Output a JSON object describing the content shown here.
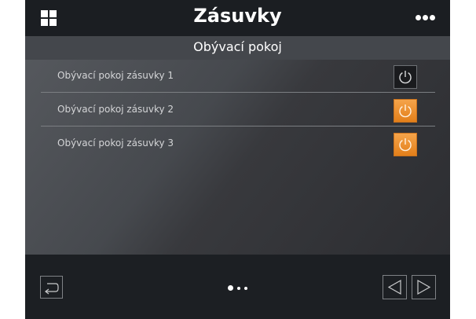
{
  "header": {
    "title": "Zásuvky",
    "menu_icon": "grid-icon",
    "more_icon": "more-dots-icon"
  },
  "room": {
    "title": "Obývací pokoj"
  },
  "outlets": [
    {
      "label": "Obývací pokoj zásuvky 1",
      "state": "off"
    },
    {
      "label": "Obývací pokoj zásuvky 2",
      "state": "on"
    },
    {
      "label": "Obývací pokoj zásuvky 3",
      "state": "on"
    }
  ],
  "footer": {
    "back_icon": "return-arrow-icon",
    "pages_total": 3,
    "page_current": 1,
    "prev_icon": "triangle-left-icon",
    "next_icon": "triangle-right-icon"
  },
  "colors": {
    "accent_on": "#e8851f",
    "off_button": "#1a1b1e",
    "background": "#1f2226"
  }
}
